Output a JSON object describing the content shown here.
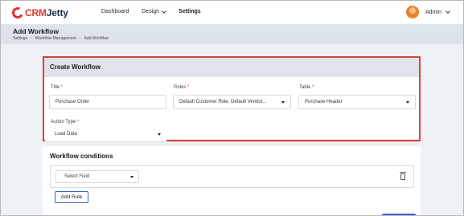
{
  "brand": {
    "name_part1": "CRM",
    "name_part2": "Jetty",
    "accent": "#e2342c"
  },
  "nav": {
    "dashboard": "Dashboard",
    "design": "Design",
    "settings": "Settings"
  },
  "user": {
    "name": "Admin"
  },
  "page": {
    "title": "Add Workflow",
    "breadcrumb": [
      "Settings",
      "Workflow Management",
      "Add Workflow"
    ]
  },
  "create_workflow": {
    "heading": "Create Workflow",
    "title_label": "Title",
    "title_value": "Purchase Order",
    "roles_label": "Roles",
    "roles_value": "Default Customer Role, Default Vendor...",
    "table_label": "Table",
    "table_value": "Purchase Header",
    "action_type_label": "Action Type",
    "action_type_value": "Load Data",
    "required_mark": "*"
  },
  "conditions": {
    "heading": "Workflow conditions",
    "select_placeholder": "Select Field",
    "add_rule": "Add Rule"
  },
  "icons": [
    "logo-mark-icon",
    "chevron-down-icon",
    "avatar",
    "trash-icon",
    "caret-down-icon"
  ]
}
